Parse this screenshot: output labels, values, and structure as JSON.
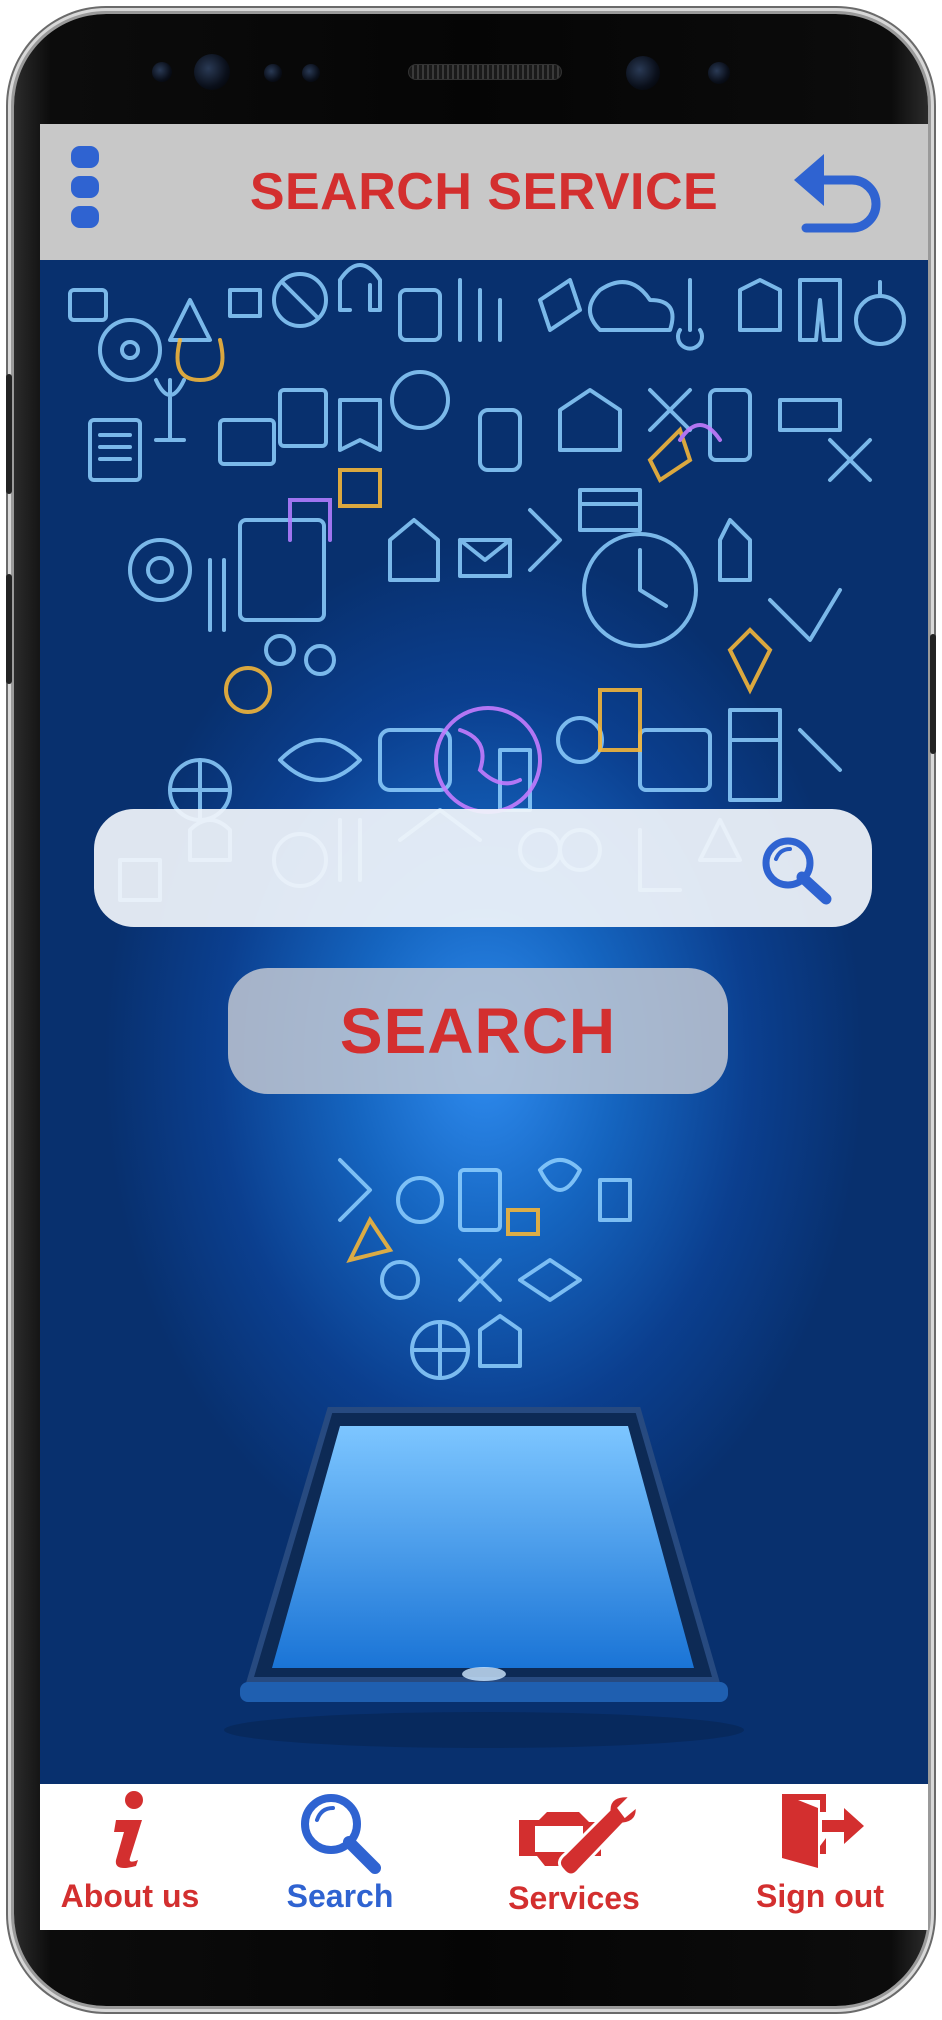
{
  "header": {
    "title": "SEARCH SERVICE"
  },
  "search": {
    "value": "",
    "placeholder": "",
    "button_label": "SEARCH"
  },
  "bottom_nav": {
    "items": [
      {
        "label": "About us",
        "icon": "info-icon",
        "color": "#d32f2f"
      },
      {
        "label": "Search",
        "icon": "search-icon",
        "color": "#2f63d1"
      },
      {
        "label": "Services",
        "icon": "engine-wrench-icon",
        "color": "#d32f2f"
      },
      {
        "label": "Sign out",
        "icon": "exit-door-icon",
        "color": "#d32f2f"
      }
    ]
  },
  "colors": {
    "accent_red": "#d32f2f",
    "accent_blue": "#2f63d1",
    "header_bg": "#c8c8c8",
    "screen_bg": "#0b3f8f"
  }
}
